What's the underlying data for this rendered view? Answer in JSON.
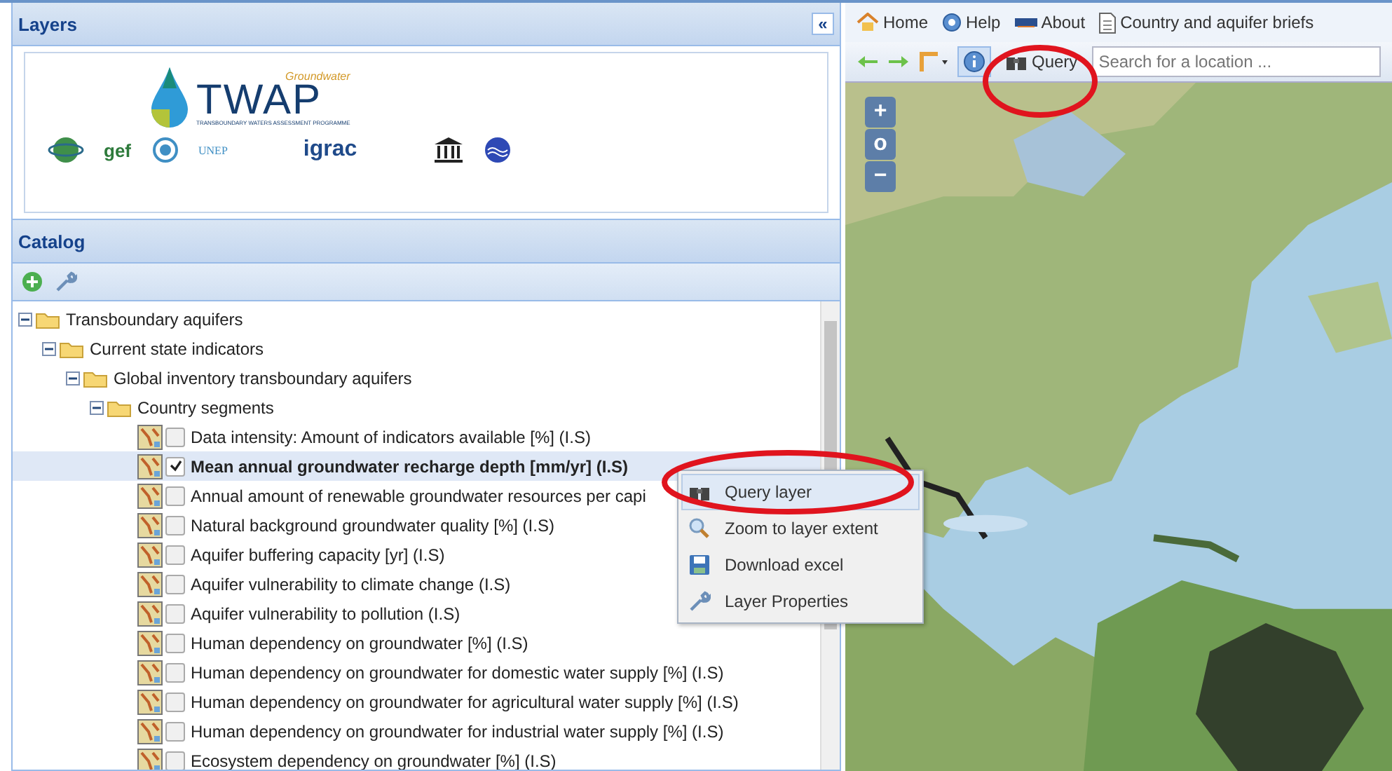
{
  "layers_panel": {
    "title": "Layers",
    "collapse_label": "«",
    "logos": {
      "tagline": "Groundwater",
      "name": "TWAP",
      "subtitle": "TRANSBOUNDARY WATERS ASSESSMENT PROGRAMME",
      "partners": [
        "gef",
        "UNEP",
        "igrac"
      ]
    }
  },
  "catalog": {
    "title": "Catalog",
    "tree": [
      {
        "kind": "folder",
        "label": "Transboundary aquifers",
        "expanded": true,
        "children": [
          {
            "kind": "folder",
            "label": "Current state indicators",
            "expanded": true,
            "children": [
              {
                "kind": "folder",
                "label": "Global inventory transboundary aquifers",
                "expanded": true,
                "children": [
                  {
                    "kind": "folder",
                    "label": "Country segments",
                    "expanded": true,
                    "children": [
                      {
                        "kind": "layer",
                        "label": "Data intensity: Amount of indicators available [%] (I.S)",
                        "checked": false,
                        "selected": false
                      },
                      {
                        "kind": "layer",
                        "label": "Mean annual groundwater recharge depth [mm/yr] (I.S)",
                        "checked": true,
                        "selected": true
                      },
                      {
                        "kind": "layer",
                        "label": "Annual amount of renewable groundwater resources per capi",
                        "checked": false,
                        "selected": false
                      },
                      {
                        "kind": "layer",
                        "label": "Natural background groundwater quality [%] (I.S)",
                        "checked": false,
                        "selected": false
                      },
                      {
                        "kind": "layer",
                        "label": "Aquifer buffering capacity [yr] (I.S)",
                        "checked": false,
                        "selected": false
                      },
                      {
                        "kind": "layer",
                        "label": "Aquifer vulnerability to climate change (I.S)",
                        "checked": false,
                        "selected": false
                      },
                      {
                        "kind": "layer",
                        "label": "Aquifer vulnerability to pollution (I.S)",
                        "checked": false,
                        "selected": false
                      },
                      {
                        "kind": "layer",
                        "label": "Human dependency on groundwater [%] (I.S)",
                        "checked": false,
                        "selected": false
                      },
                      {
                        "kind": "layer",
                        "label": "Human dependency on groundwater for domestic water supply [%] (I.S)",
                        "checked": false,
                        "selected": false
                      },
                      {
                        "kind": "layer",
                        "label": "Human dependency on groundwater for agricultural water supply [%] (I.S)",
                        "checked": false,
                        "selected": false
                      },
                      {
                        "kind": "layer",
                        "label": "Human dependency on groundwater for industrial water supply [%] (I.S)",
                        "checked": false,
                        "selected": false
                      },
                      {
                        "kind": "layer",
                        "label": "Ecosystem dependency on groundwater [%] (I.S)",
                        "checked": false,
                        "selected": false
                      }
                    ]
                  }
                ]
              }
            ]
          }
        ]
      }
    ]
  },
  "context_menu": {
    "items": [
      {
        "kind": "query",
        "label": "Query layer",
        "selected": true
      },
      {
        "kind": "zoom",
        "label": "Zoom to layer extent",
        "selected": false
      },
      {
        "kind": "download",
        "label": "Download excel",
        "selected": false
      },
      {
        "kind": "properties",
        "label": "Layer Properties",
        "selected": false
      }
    ]
  },
  "top_links": [
    {
      "kind": "home",
      "label": "Home"
    },
    {
      "kind": "help",
      "label": "Help"
    },
    {
      "kind": "about",
      "label": "About"
    },
    {
      "kind": "briefs",
      "label": "Country and aquifer briefs"
    }
  ],
  "map_toolbar": {
    "info_pressed": true,
    "query_label": "Query",
    "search": {
      "placeholder": "Search for a location ..."
    }
  },
  "map": {
    "kind": "picture",
    "zoom_controls": [
      "+",
      "o",
      "−"
    ]
  }
}
